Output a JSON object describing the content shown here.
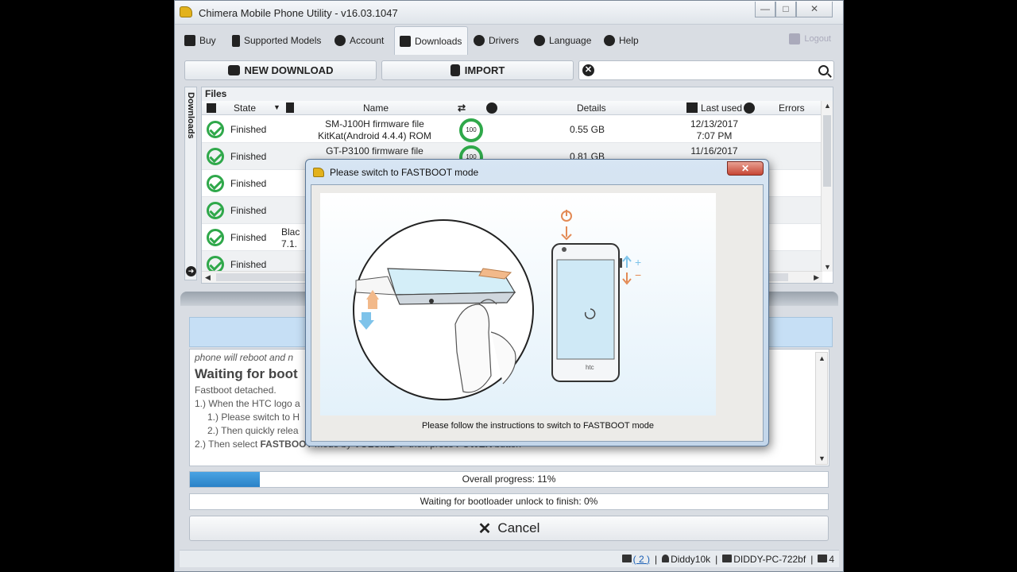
{
  "window": {
    "title": "Chimera Mobile Phone Utility - v16.03.1047",
    "min": "—",
    "max": "□",
    "close": "✕"
  },
  "menu": {
    "items": [
      {
        "label": "Buy"
      },
      {
        "label": "Supported Models"
      },
      {
        "label": "Account"
      },
      {
        "label": "Downloads"
      },
      {
        "label": "Drivers"
      },
      {
        "label": "Language"
      },
      {
        "label": "Help"
      }
    ],
    "logout": "Logout"
  },
  "toolbar": {
    "new_download": "NEW DOWNLOAD",
    "import": "IMPORT",
    "search_value": "",
    "clear": "✕"
  },
  "side_tab": {
    "label": "Downloads",
    "arrow": "➜"
  },
  "files": {
    "header": "Files",
    "columns": {
      "state": "State",
      "name": "Name",
      "details": "Details",
      "last_used": "Last used",
      "errors": "Errors"
    },
    "rows": [
      {
        "state": "Finished",
        "name1": "SM-J100H firmware file",
        "name2": "KitKat(Android 4.4.4) ROM",
        "progress": "100",
        "size": "0.55 GB",
        "date": "12/13/2017",
        "time": "7:07 PM"
      },
      {
        "state": "Finished",
        "name1": "GT-P3100 firmware file",
        "name2": "",
        "progress": "100",
        "size": "0.81 GB",
        "date": "11/16/2017",
        "time": ""
      },
      {
        "state": "Finished",
        "name1": "",
        "name2": "",
        "progress": "",
        "size": "",
        "date": "",
        "time": ""
      },
      {
        "state": "Finished",
        "name1": "",
        "name2": "",
        "progress": "",
        "size": "",
        "date": "",
        "time": ""
      },
      {
        "state": "Finished",
        "name1": "Blac",
        "name2": "7.1.",
        "progress": "",
        "size": "",
        "date": "",
        "time": ""
      },
      {
        "state": "Finished",
        "name1": "",
        "name2": "",
        "progress": "",
        "size": "",
        "date": "",
        "time": ""
      }
    ]
  },
  "log": {
    "line0": "phone will reboot and n",
    "title": "Waiting for boot",
    "line1": "Fastboot detached.",
    "line2": "1.) When the HTC logo a",
    "line3": "1.) Please switch to H",
    "line4": "2.) Then quickly relea",
    "line5_pre": "2.) Then select ",
    "line5_b1": "FASTBOOT",
    "line5_mid": " mode by ",
    "line5_b2": "VOLUME+/-",
    "line5_mid2": " then press ",
    "line5_b3": "POWER",
    "line5_post": " button"
  },
  "progress": {
    "overall_label": "Overall progress: 11%",
    "overall_value": 0.11,
    "unlock_label": "Waiting for bootloader unlock to finish: 0%",
    "unlock_value": 0
  },
  "cancel": {
    "label": "Cancel",
    "icon": "✕"
  },
  "statusbar": {
    "messages": "( 2 )",
    "user": "Diddy10k",
    "pc": "DIDDY-PC-722bf",
    "count": "4"
  },
  "dialog": {
    "title": "Please switch to FASTBOOT mode",
    "close": "✕",
    "message": "Please follow the instructions to switch to FASTBOOT mode",
    "phone_brand": "htc",
    "plus": "+",
    "minus": "−"
  }
}
